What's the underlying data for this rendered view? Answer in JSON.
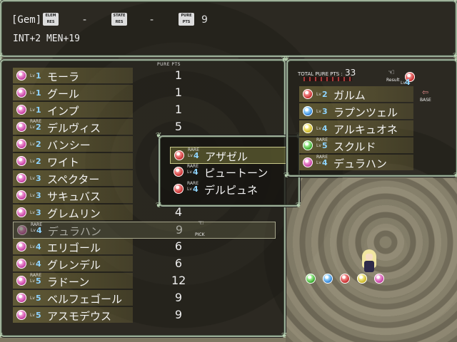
{
  "header": {
    "gem_label": "[Gem]",
    "elem_res": [
      "ELEM",
      "RES"
    ],
    "state_res": [
      "STATE",
      "RES"
    ],
    "pure_pts": [
      "PURE",
      "PTS"
    ],
    "elem_value": "-",
    "state_value": "-",
    "pure_value": "9",
    "stats": "INT+2 MEN+19"
  },
  "list": {
    "column_header": "PURE PTS",
    "pick_label": "PICK",
    "items": [
      {
        "name": "モーラ",
        "lv": "1",
        "rare": false,
        "pts": "1",
        "color": "pink"
      },
      {
        "name": "グール",
        "lv": "1",
        "rare": false,
        "pts": "1",
        "color": "pink"
      },
      {
        "name": "インプ",
        "lv": "1",
        "rare": false,
        "pts": "1",
        "color": "pink"
      },
      {
        "name": "デルヴィス",
        "lv": "2",
        "rare": true,
        "pts": "5",
        "color": "pink"
      },
      {
        "name": "バンシー",
        "lv": "2",
        "rare": false,
        "pts": "",
        "color": "pink"
      },
      {
        "name": "ワイト",
        "lv": "2",
        "rare": false,
        "pts": "",
        "color": "pink"
      },
      {
        "name": "スペクター",
        "lv": "3",
        "rare": false,
        "pts": "",
        "color": "pink"
      },
      {
        "name": "サキュバス",
        "lv": "3",
        "rare": false,
        "pts": "",
        "color": "pink"
      },
      {
        "name": "グレムリン",
        "lv": "3",
        "rare": false,
        "pts": "4",
        "color": "pink"
      },
      {
        "name": "デュラハン",
        "lv": "4",
        "rare": true,
        "pts": "9",
        "color": "pink",
        "selected": true
      },
      {
        "name": "エリゴール",
        "lv": "4",
        "rare": false,
        "pts": "6",
        "color": "pink"
      },
      {
        "name": "グレンデル",
        "lv": "4",
        "rare": false,
        "pts": "6",
        "color": "pink"
      },
      {
        "name": "ラドーン",
        "lv": "5",
        "rare": true,
        "pts": "12",
        "color": "pink"
      },
      {
        "name": "ベルフェゴール",
        "lv": "5",
        "rare": false,
        "pts": "9",
        "color": "pink"
      },
      {
        "name": "アスモデウス",
        "lv": "5",
        "rare": false,
        "pts": "9",
        "color": "pink"
      }
    ]
  },
  "popup": {
    "items": [
      {
        "name": "アザゼル",
        "lv": "4",
        "rare": true,
        "selected": true
      },
      {
        "name": "ピュートーン",
        "lv": "4",
        "rare": true
      },
      {
        "name": "デルピュネ",
        "lv": "4",
        "rare": true
      }
    ]
  },
  "result_panel": {
    "total_label": "TOTAL PURE PTS :",
    "total_value": "33",
    "result_label": "Result",
    "result_lv": "4",
    "base_label": "BASE",
    "items": [
      {
        "name": "ガルム",
        "lv": "2",
        "rare": false,
        "color": "red"
      },
      {
        "name": "ラプンツェル",
        "lv": "3",
        "rare": false,
        "color": "blue"
      },
      {
        "name": "アルキュオネ",
        "lv": "4",
        "rare": false,
        "color": "yellow"
      },
      {
        "name": "スクルド",
        "lv": "5",
        "rare": true,
        "color": "green"
      },
      {
        "name": "デュラハン",
        "lv": "4",
        "rare": true,
        "color": "pink"
      }
    ]
  },
  "field": {
    "orbs": [
      "green",
      "blue",
      "red",
      "yellow",
      "pink"
    ]
  }
}
